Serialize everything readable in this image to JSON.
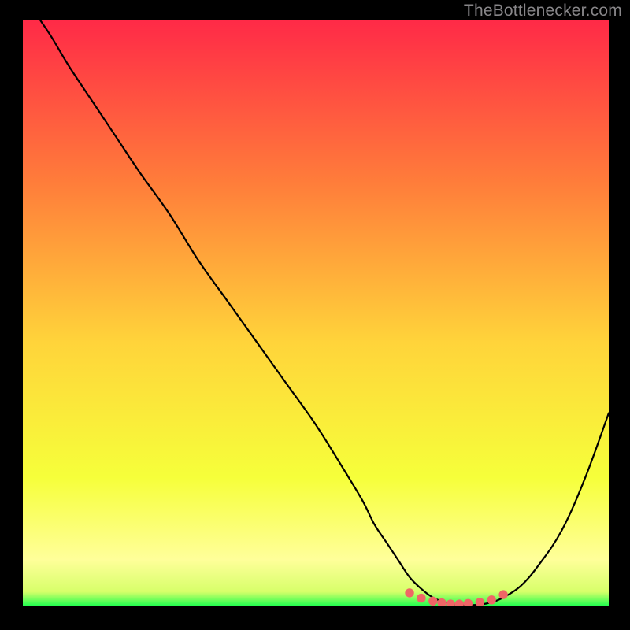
{
  "watermark": "TheBottlenecker.com",
  "colors": {
    "frame_bg": "#000000",
    "gradient_top": "#ff2a47",
    "gradient_mid_upper": "#ff7e3a",
    "gradient_mid": "#ffd43a",
    "gradient_lower": "#f6ff3a",
    "gradient_band": "#ffff9a",
    "gradient_green": "#1aff4e",
    "curve_stroke": "#000000",
    "marker_fill": "#ef6666",
    "marker_stroke": "#ef6666"
  },
  "chart_data": {
    "type": "line",
    "title": "",
    "xlabel": "",
    "ylabel": "",
    "xlim": [
      0,
      100
    ],
    "ylim": [
      0,
      100
    ],
    "x": [
      3,
      5,
      8,
      12,
      16,
      20,
      25,
      30,
      35,
      40,
      45,
      50,
      55,
      58,
      60,
      62,
      64,
      66,
      68,
      70,
      72,
      74,
      76,
      78,
      80,
      82,
      85,
      88,
      92,
      96,
      100
    ],
    "y": [
      100,
      97,
      92,
      86,
      80,
      74,
      67,
      59,
      52,
      45,
      38,
      31,
      23,
      18,
      14,
      11,
      8,
      5,
      3,
      1.5,
      0.7,
      0.3,
      0.2,
      0.3,
      0.7,
      1.5,
      3.5,
      7,
      13,
      22,
      33
    ],
    "markers": {
      "x": [
        66,
        68,
        70,
        71.5,
        73,
        74.5,
        76,
        78,
        80,
        82
      ],
      "y": [
        2.3,
        1.4,
        0.9,
        0.6,
        0.4,
        0.4,
        0.5,
        0.7,
        1.1,
        2.0
      ]
    },
    "annotations": []
  }
}
